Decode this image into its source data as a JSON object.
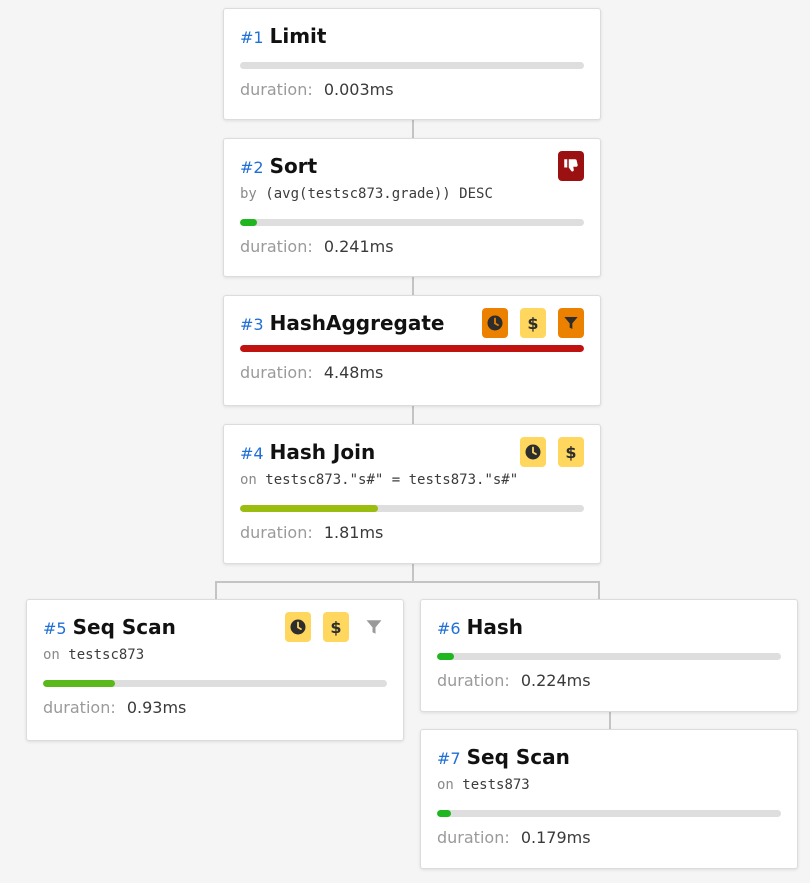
{
  "duration_label": "duration:",
  "nodes": {
    "n1": {
      "id": "#1",
      "type": "Limit",
      "duration": "0.003ms",
      "progress": 0.0,
      "bar_color": "#c4c4c4"
    },
    "n2": {
      "id": "#2",
      "type": "Sort",
      "detail_kw": "by",
      "detail": "(avg(testsc873.grade)) DESC",
      "duration": "0.241ms",
      "progress": 0.05,
      "bar_color": "#1fb61f",
      "badges": [
        "thumbs-down-icon"
      ]
    },
    "n3": {
      "id": "#3",
      "type": "HashAggregate",
      "duration": "4.48ms",
      "progress": 1.0,
      "bar_color": "#c0130f",
      "badges": [
        "clock-icon",
        "dollar-icon",
        "filter-icon"
      ]
    },
    "n4": {
      "id": "#4",
      "type": "Hash Join",
      "detail_kw": "on",
      "detail": "testsc873.\"s#\" = tests873.\"s#\"",
      "duration": "1.81ms",
      "progress": 0.4,
      "bar_color": "#9bbd0f",
      "badges": [
        "clock-icon",
        "dollar-icon"
      ]
    },
    "n5": {
      "id": "#5",
      "type": "Seq Scan",
      "detail_kw": "on",
      "detail": "testsc873",
      "duration": "0.93ms",
      "progress": 0.21,
      "bar_color": "#5ab81a",
      "badges": [
        "clock-icon",
        "dollar-icon",
        "filter-icon"
      ]
    },
    "n6": {
      "id": "#6",
      "type": "Hash",
      "duration": "0.224ms",
      "progress": 0.05,
      "bar_color": "#1fb61f"
    },
    "n7": {
      "id": "#7",
      "type": "Seq Scan",
      "detail_kw": "on",
      "detail": "tests873",
      "duration": "0.179ms",
      "progress": 0.04,
      "bar_color": "#1fb61f"
    }
  },
  "badge_symbols": {
    "clock": "◷",
    "dollar": "$",
    "filter": "▼",
    "thumbs_down": "👎"
  }
}
